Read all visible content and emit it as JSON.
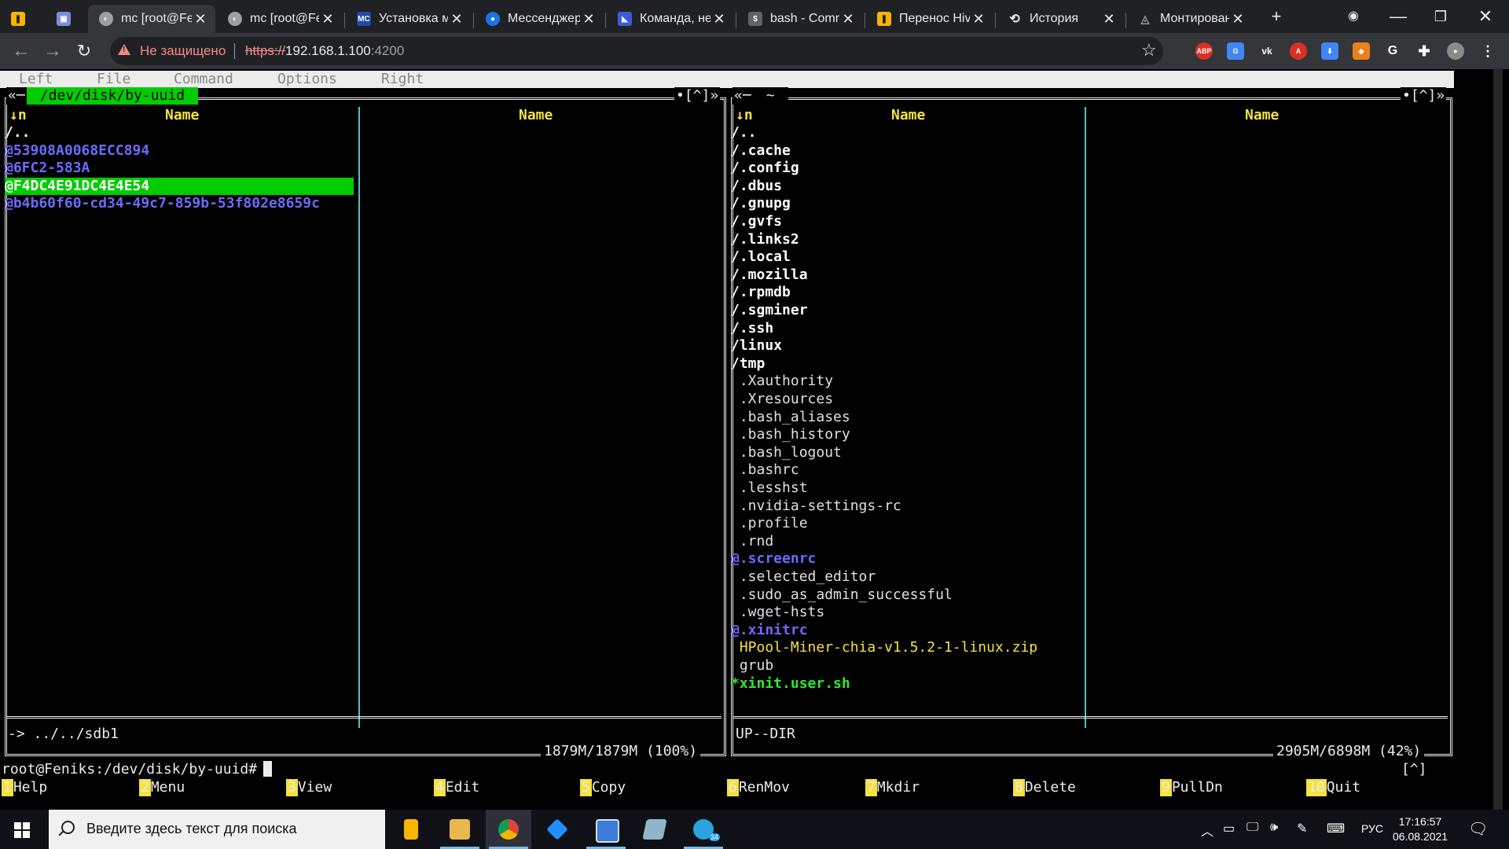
{
  "browser": {
    "tabs": [
      {
        "label": "",
        "active": false,
        "icon": "cloud-icon"
      },
      {
        "label": "",
        "active": false,
        "icon": "page-icon"
      },
      {
        "label": "mc [root@Fe",
        "active": true,
        "icon": "terminal-tab-icon"
      },
      {
        "label": "mc [root@Fe",
        "active": false,
        "icon": "terminal-tab-icon"
      },
      {
        "label": "Установка м",
        "active": false,
        "icon": "ms-site-icon"
      },
      {
        "label": "Мессенджер",
        "active": false,
        "icon": "messenger-icon"
      },
      {
        "label": "Команда, не",
        "active": false,
        "icon": "flag-icon"
      },
      {
        "label": "bash - Comn",
        "active": false,
        "icon": "bash-icon"
      },
      {
        "label": "Перенос Hiv",
        "active": false,
        "icon": "hive-icon"
      },
      {
        "label": "История",
        "active": false,
        "icon": "history-icon"
      },
      {
        "label": "Монтирован",
        "active": false,
        "icon": "drive-icon"
      }
    ],
    "new_tab": "+",
    "security_label": "Не защищено",
    "url_scheme": "https://",
    "url_host": "192.168.1.100",
    "url_port": ":4200"
  },
  "mc": {
    "menu": [
      "Left",
      "File",
      "Command",
      "Options",
      "Right"
    ],
    "left": {
      "title": " /dev/disk/by-uuid ",
      "corner_left": "«─",
      "corner_right": "•[^]»",
      "sort_indicator": "↓n",
      "col_name": "Name",
      "col_name2": "Name",
      "entries": [
        {
          "text": "/..",
          "kind": "dir"
        },
        {
          "text": "@53908A0068ECC894",
          "kind": "link"
        },
        {
          "text": "@6FC2-583A",
          "kind": "link"
        },
        {
          "text": "@F4DC4E91DC4E4E54",
          "kind": "sel"
        },
        {
          "text": "@b4b60f60-cd34-49c7-859b-53f802e8659c",
          "kind": "link"
        }
      ],
      "mini_status": "-> ../../sdb1",
      "space": "1879M/1879M (100%)"
    },
    "right": {
      "title": " ~ ",
      "corner_left": "«─",
      "corner_right": "•[^]»",
      "sort_indicator": "↓n",
      "col_name": "Name",
      "col_name2": "Name",
      "entries": [
        {
          "text": "/..",
          "kind": "dir"
        },
        {
          "text": "/.cache",
          "kind": "dir"
        },
        {
          "text": "/.config",
          "kind": "dir"
        },
        {
          "text": "/.dbus",
          "kind": "dir"
        },
        {
          "text": "/.gnupg",
          "kind": "dir"
        },
        {
          "text": "/.gvfs",
          "kind": "dir"
        },
        {
          "text": "/.links2",
          "kind": "dir"
        },
        {
          "text": "/.local",
          "kind": "dir"
        },
        {
          "text": "/.mozilla",
          "kind": "dir"
        },
        {
          "text": "/.rpmdb",
          "kind": "dir"
        },
        {
          "text": "/.sgminer",
          "kind": "dir"
        },
        {
          "text": "/.ssh",
          "kind": "dir"
        },
        {
          "text": "/linux",
          "kind": "dir"
        },
        {
          "text": "/tmp",
          "kind": "dir"
        },
        {
          "text": " .Xauthority",
          "kind": "file"
        },
        {
          "text": " .Xresources",
          "kind": "file"
        },
        {
          "text": " .bash_aliases",
          "kind": "file"
        },
        {
          "text": " .bash_history",
          "kind": "file"
        },
        {
          "text": " .bash_logout",
          "kind": "file"
        },
        {
          "text": " .bashrc",
          "kind": "file"
        },
        {
          "text": " .lesshst",
          "kind": "file"
        },
        {
          "text": " .nvidia-settings-rc",
          "kind": "file"
        },
        {
          "text": " .profile",
          "kind": "file"
        },
        {
          "text": " .rnd",
          "kind": "file"
        },
        {
          "text": "@.screenrc",
          "kind": "link"
        },
        {
          "text": " .selected_editor",
          "kind": "file"
        },
        {
          "text": " .sudo_as_admin_successful",
          "kind": "file"
        },
        {
          "text": " .wget-hsts",
          "kind": "file"
        },
        {
          "text": "@.xinitrc",
          "kind": "link"
        },
        {
          "text": " HPool-Miner-chia-v1.5.2-1-linux.zip",
          "kind": "arch"
        },
        {
          "text": " grub",
          "kind": "file"
        },
        {
          "text": "*xinit.user.sh",
          "kind": "exec"
        }
      ],
      "mini_status": "UP--DIR",
      "space": "2905M/6898M (42%)"
    },
    "prompt": "root@Feniks:/dev/disk/by-uuid#",
    "history_hint": "[^]",
    "fkeys": [
      {
        "num": "1",
        "label": "Help"
      },
      {
        "num": "2",
        "label": "Menu"
      },
      {
        "num": "3",
        "label": "View"
      },
      {
        "num": "4",
        "label": "Edit"
      },
      {
        "num": "5",
        "label": "Copy"
      },
      {
        "num": "6",
        "label": "RenMov"
      },
      {
        "num": "7",
        "label": "Mkdir"
      },
      {
        "num": "8",
        "label": "Delete"
      },
      {
        "num": "9",
        "label": "PullDn"
      },
      {
        "num": "10",
        "label": "Quit"
      }
    ]
  },
  "taskbar": {
    "search_placeholder": "Введите здесь текст для поиска",
    "apps": [
      "keep-icon",
      "explorer-icon",
      "chrome-icon",
      "sourcetree-icon",
      "notepad-icon",
      "notes-icon",
      "telegram-icon"
    ],
    "language": "РУС",
    "time": "17:16:57",
    "date": "06.08.2021",
    "telegram_badge": "34"
  },
  "colors": {
    "mc_selected": "#00cc00",
    "mc_link": "#6b6bff",
    "mc_header": "#f5e23c",
    "mc_exec": "#2ee82e"
  }
}
